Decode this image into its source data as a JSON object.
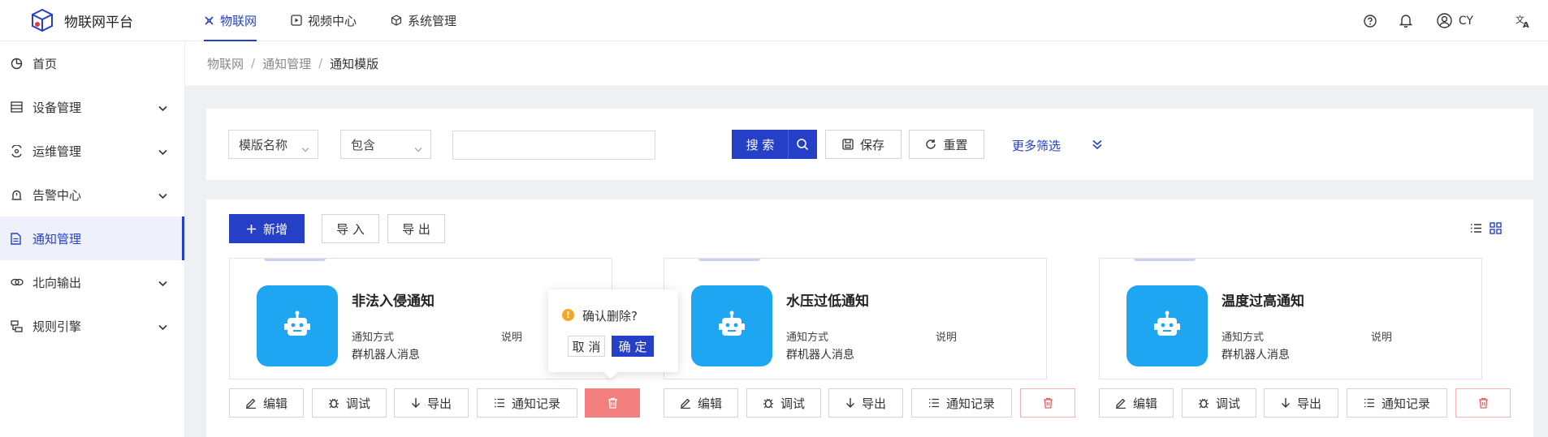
{
  "app": {
    "title": "物联网平台"
  },
  "topnav": [
    {
      "label": "物联网",
      "icon": "iot-icon",
      "active": true
    },
    {
      "label": "视频中心",
      "icon": "video-icon",
      "active": false
    },
    {
      "label": "系统管理",
      "icon": "cube-icon",
      "active": false
    }
  ],
  "user": {
    "name": "CY"
  },
  "sidebar": {
    "items": [
      {
        "label": "首页",
        "icon": "pie-chart-icon",
        "has_children": false
      },
      {
        "label": "设备管理",
        "icon": "device-list-icon",
        "has_children": true
      },
      {
        "label": "运维管理",
        "icon": "shield-icon",
        "has_children": true
      },
      {
        "label": "告警中心",
        "icon": "alarm-icon",
        "has_children": true
      },
      {
        "label": "通知管理",
        "icon": "document-icon",
        "has_children": false,
        "active": true
      },
      {
        "label": "北向输出",
        "icon": "link-icon",
        "has_children": true
      },
      {
        "label": "规则引擎",
        "icon": "rules-icon",
        "has_children": true
      }
    ]
  },
  "breadcrumb": [
    "物联网",
    "通知管理",
    "通知模版"
  ],
  "filter": {
    "field": "模版名称",
    "operator": "包含",
    "value": "",
    "search_label": "搜 索",
    "save_label": "保存",
    "reset_label": "重置",
    "more_label": "更多筛选"
  },
  "toolbar": {
    "add_label": "新增",
    "import_label": "导 入",
    "export_label": "导 出"
  },
  "cards": [
    {
      "title": "非法入侵通知",
      "method_label": "通知方式",
      "method_value": "群机器人消息",
      "desc_label": "说明"
    },
    {
      "title": "水压过低通知",
      "method_label": "通知方式",
      "method_value": "群机器人消息",
      "desc_label": "说明"
    },
    {
      "title": "温度过高通知",
      "method_label": "通知方式",
      "method_value": "群机器人消息",
      "desc_label": "说明"
    }
  ],
  "card_actions": {
    "edit": "编辑",
    "debug": "调试",
    "export": "导出",
    "records": "通知记录"
  },
  "popconfirm": {
    "message": "确认删除?",
    "cancel": "取 消",
    "ok": "确 定"
  },
  "colors": {
    "primary": "#2540c6",
    "avatar": "#1ea6f2",
    "danger": "#f47f7f",
    "warning": "#f5a623"
  }
}
